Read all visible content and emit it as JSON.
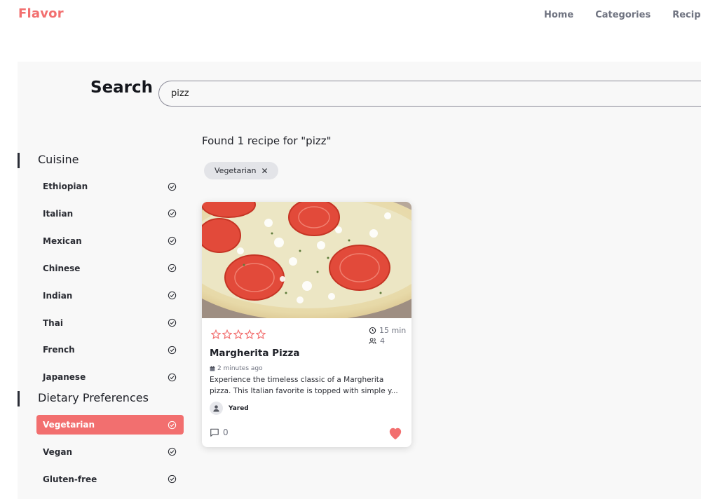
{
  "header": {
    "brand": "Flavor",
    "nav": [
      "Home",
      "Categories",
      "Recipe"
    ]
  },
  "search": {
    "label": "Search",
    "value": "pizz",
    "placeholder": ""
  },
  "sidebar": {
    "cuisine_title": "Cuisine",
    "cuisine": [
      "Ethiopian",
      "Italian",
      "Mexican",
      "Chinese",
      "Indian",
      "Thai",
      "French",
      "Japanese"
    ],
    "dietary_title": "Dietary Preferences",
    "dietary": [
      "Vegetarian",
      "Vegan",
      "Gluten-free"
    ],
    "active_filter": "Vegetarian",
    "check_icon": "check-circle-icon"
  },
  "results": {
    "found_text": "Found 1 recipe for \"pizz\"",
    "active_chip": "Vegetarian",
    "chip_remove_icon": "close-icon"
  },
  "recipe_card": {
    "title": "Margherita Pizza",
    "rating": 0,
    "rating_max": 5,
    "cook_time": "15 min",
    "servings": "4",
    "posted": "2 minutes ago",
    "description": "Experience the timeless classic of a Margherita pizza. This Italian favorite is topped with simple y...",
    "author": "Yared",
    "comments": "0",
    "favorited": true
  },
  "colors": {
    "accent": "#f26f6f",
    "text_dark": "#1f2128",
    "muted": "#6f7380",
    "panel_bg": "#f8f8f8"
  }
}
